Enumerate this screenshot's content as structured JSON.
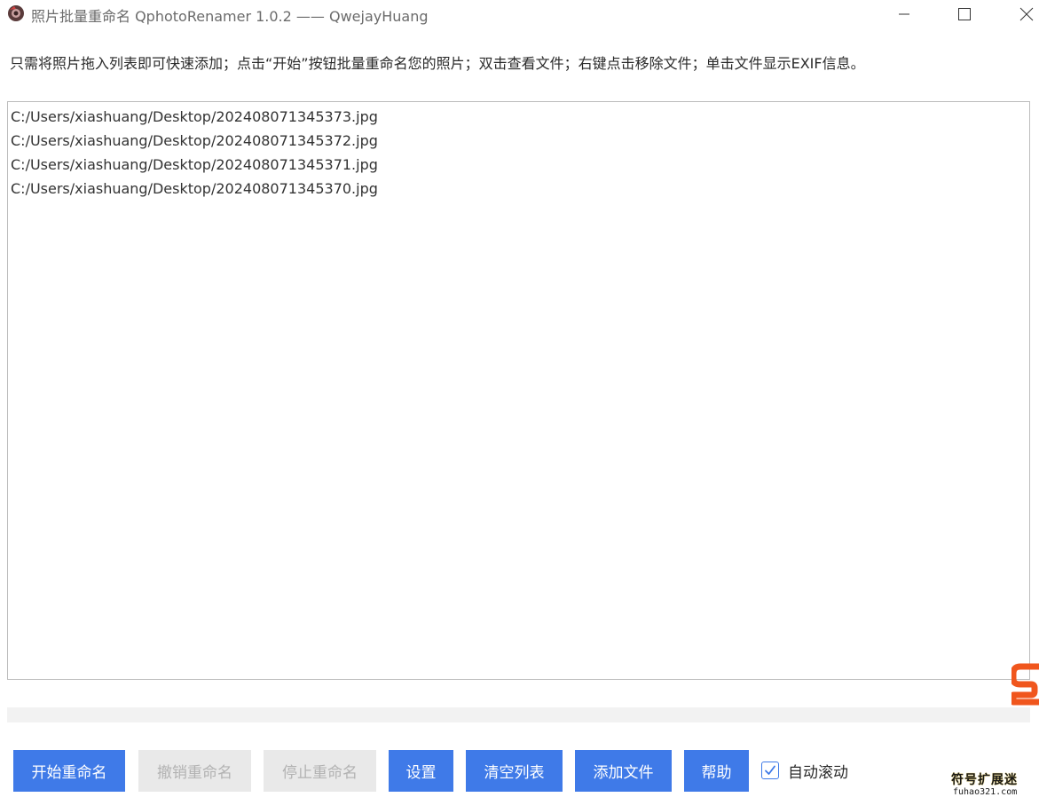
{
  "window": {
    "title": "照片批量重命名 QphotoRenamer 1.0.2 —— QwejayHuang"
  },
  "hint": "只需将照片拖入列表即可快速添加；点击“开始”按钮批量重命名您的照片；双击查看文件；右键点击移除文件；单击文件显示EXIF信息。",
  "files": [
    "C:/Users/xiashuang/Desktop/202408071345373.jpg",
    "C:/Users/xiashuang/Desktop/202408071345372.jpg",
    "C:/Users/xiashuang/Desktop/202408071345371.jpg",
    "C:/Users/xiashuang/Desktop/202408071345370.jpg"
  ],
  "progress": 0,
  "toolbar": {
    "start_label": "开始重命名",
    "undo_label": "撤销重命名",
    "stop_label": "停止重命名",
    "settings_label": "设置",
    "clear_label": "清空列表",
    "add_label": "添加文件",
    "help_label": "帮助",
    "auto_scroll_label": "自动滚动",
    "auto_scroll_checked": true
  },
  "watermark": {
    "line1": "符号扩展迷",
    "line2": "fuhao321.com"
  },
  "colors": {
    "accent": "#3f7ae8",
    "disabled_bg": "#e9e9e9",
    "disabled_text": "#b2b2b2",
    "logo_orange": "#f0561d"
  },
  "icons": {
    "app": "app-camera-icon",
    "minimize": "minimize-icon",
    "maximize": "maximize-icon",
    "close": "close-icon",
    "check": "check-icon",
    "side_logo": "sogou-logo-icon"
  }
}
